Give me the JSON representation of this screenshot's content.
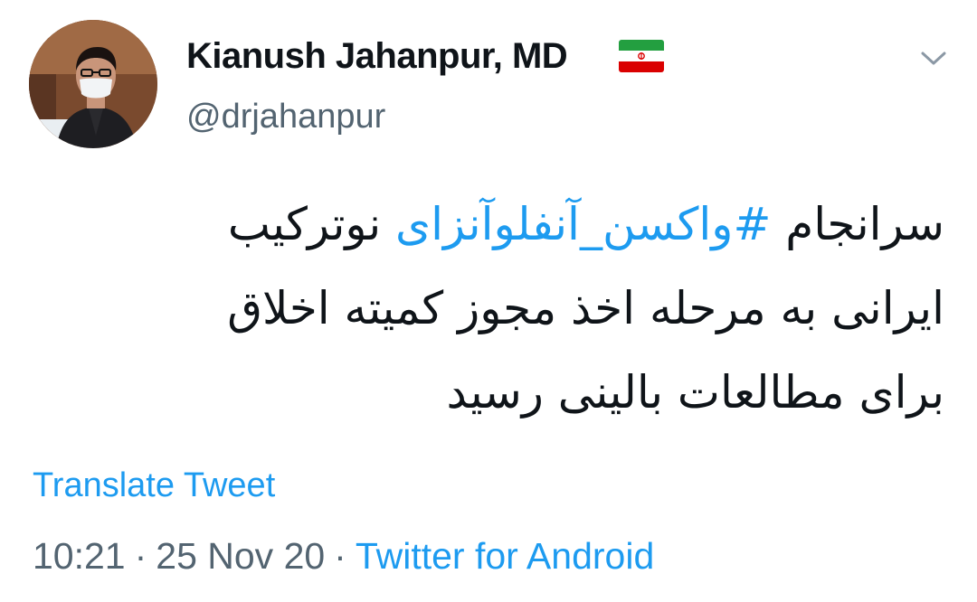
{
  "author": {
    "display_name": "Kianush Jahanpur, MD",
    "handle": "@drjahanpur",
    "flag_icon": "iran-flag-icon",
    "avatar_icon": "profile-photo-avatar"
  },
  "menu": {
    "icon": "chevron-down-icon"
  },
  "tweet": {
    "line1_pre": "سرانجام ",
    "hashtag": "#واکسن_آنفلوآنزای",
    "line1_post": " نوترکیب",
    "line2": "ایرانی به مرحله اخذ مجوز کمیته اخلاق",
    "line3": "برای مطالعات بالینی رسید"
  },
  "translate_label": "Translate Tweet",
  "meta": {
    "time": "10:21",
    "separator": "·",
    "date": "25 Nov 20",
    "source": "Twitter for Android"
  },
  "colors": {
    "link": "#1d9bf0",
    "secondary": "#536471",
    "text": "#0f1419"
  }
}
